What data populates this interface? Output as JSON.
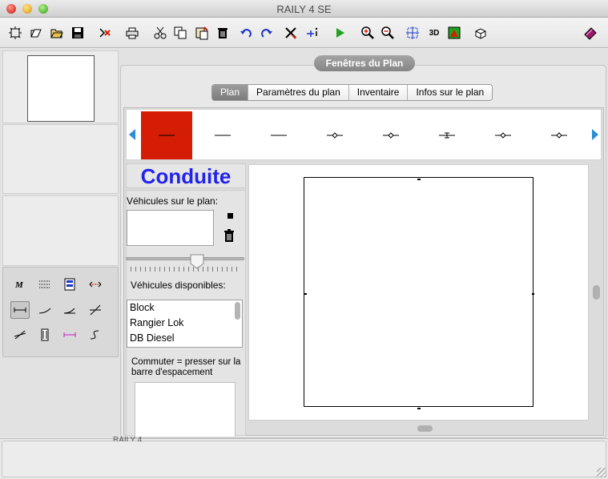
{
  "window": {
    "title": "RAILY 4 SE"
  },
  "toolbar": {
    "buttons": [
      {
        "icon": "new-plan-icon"
      },
      {
        "icon": "open-icon"
      },
      {
        "icon": "open-folder-icon"
      },
      {
        "icon": "save-icon"
      },
      {
        "icon": "export-icon"
      },
      {
        "icon": "print-icon"
      },
      {
        "icon": "cut-icon"
      },
      {
        "icon": "copy-icon"
      },
      {
        "icon": "paste-icon"
      },
      {
        "icon": "delete-icon"
      },
      {
        "icon": "undo-icon"
      },
      {
        "icon": "redo-icon"
      },
      {
        "icon": "tools-icon"
      },
      {
        "icon": "info-icon"
      },
      {
        "icon": "play-icon"
      },
      {
        "icon": "zoom-in-icon"
      },
      {
        "icon": "zoom-out-icon"
      },
      {
        "icon": "fit-icon"
      },
      {
        "icon": "3d-icon"
      },
      {
        "icon": "landscape-icon"
      },
      {
        "icon": "cube-icon"
      },
      {
        "icon": "help-book-icon"
      }
    ],
    "label_3d": "3D"
  },
  "group": {
    "label": "Fenêtres du Plan"
  },
  "tabs": [
    {
      "label": "Plan",
      "active": true
    },
    {
      "label": "Paramètres du plan",
      "active": false
    },
    {
      "label": "Inventaire",
      "active": false
    },
    {
      "label": "Infos sur le plan",
      "active": false
    }
  ],
  "track_strip": {
    "selected_index": 0,
    "items": [
      "straight",
      "straight",
      "straight",
      "straight-dot",
      "straight-dot",
      "straight-x",
      "straight-dot",
      "straight-dot"
    ],
    "selected_color": "#d41d04"
  },
  "conduite": {
    "title": "Conduite",
    "title_color": "#2222ee",
    "vehicles_on_plan_label": "Véhicules sur le plan:",
    "available_label": "Véhicules disponibles:",
    "available": [
      "Block",
      "Rangier Lok",
      "DB Diesel"
    ],
    "hint": "Commuter = presser sur la barre d'espacement"
  },
  "status": {
    "text": "RAILY 4"
  }
}
